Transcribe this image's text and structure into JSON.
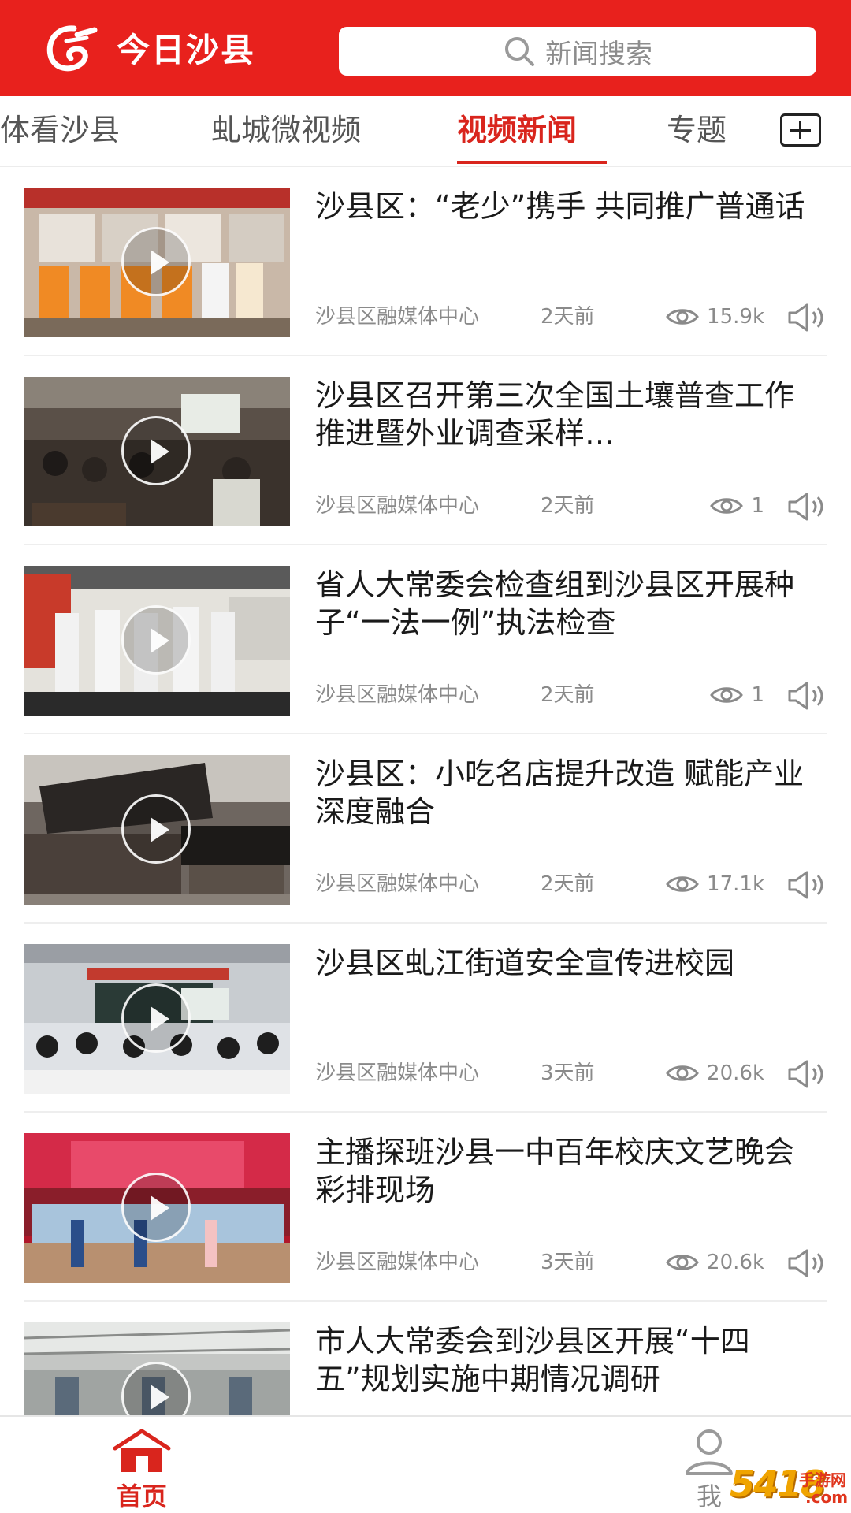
{
  "header": {
    "app_title": "今日沙县",
    "search_placeholder": "新闻搜索"
  },
  "tabs": [
    {
      "label": "体看沙县"
    },
    {
      "label": "虬城微视频"
    },
    {
      "label": "视频新闻",
      "active": true
    },
    {
      "label": "专题"
    }
  ],
  "news": [
    {
      "title": "沙县区：“老少”携手 共同推广普通话",
      "source": "沙县区融媒体中心",
      "time": "2天前",
      "views": "15.9k"
    },
    {
      "title": "沙县区召开第三次全国土壤普查工作推进暨外业调查采样…",
      "source": "沙县区融媒体中心",
      "time": "2天前",
      "views": "1"
    },
    {
      "title": "省人大常委会检查组到沙县区开展种子“一法一例”执法检查",
      "source": "沙县区融媒体中心",
      "time": "2天前",
      "views": "1"
    },
    {
      "title": "沙县区：小吃名店提升改造 赋能产业深度融合",
      "source": "沙县区融媒体中心",
      "time": "2天前",
      "views": "17.1k"
    },
    {
      "title": "沙县区虬江街道安全宣传进校园",
      "source": "沙县区融媒体中心",
      "time": "3天前",
      "views": "20.6k"
    },
    {
      "title": "主播探班沙县一中百年校庆文艺晚会彩排现场",
      "source": "沙县区融媒体中心",
      "time": "3天前",
      "views": "20.6k"
    },
    {
      "title": "市人大常委会到沙县区开展“十四五”规划实施中期情况调研",
      "source": "",
      "time": "",
      "views": ""
    }
  ],
  "bottom_nav": {
    "home_label": "首页",
    "me_label": "我"
  },
  "watermark": {
    "big": "5418",
    "cn": "手游网",
    "com": ".com"
  },
  "colors": {
    "brand_red": "#e8211d",
    "active_tab": "#d9251d",
    "meta_gray": "#8a8a8a"
  }
}
